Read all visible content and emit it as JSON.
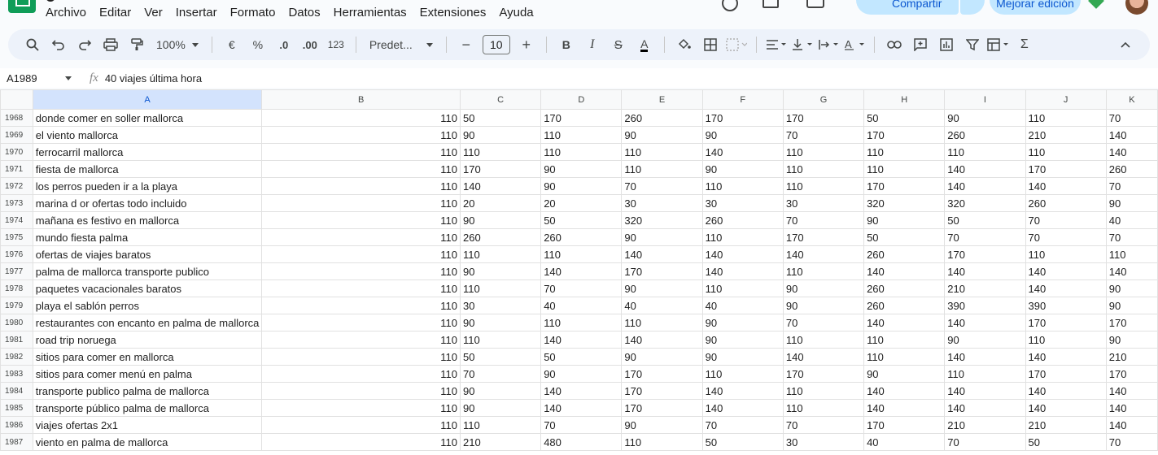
{
  "menubar": [
    "Archivo",
    "Editar",
    "Ver",
    "Insertar",
    "Formato",
    "Datos",
    "Herramientas",
    "Extensiones",
    "Ayuda"
  ],
  "header_buttons": {
    "share": "Compartir",
    "upgrade": "Mejorar edición"
  },
  "toolbar": {
    "zoom": "100%",
    "currency": "€",
    "percent": "%",
    "decrease_decimals": ".0",
    "increase_decimals": ".00",
    "format_123": "123",
    "font": "Predet...",
    "font_size": "10",
    "bold": "B",
    "italic": "I",
    "strike": "S",
    "text_color": "A",
    "sum": "Σ"
  },
  "formula_bar": {
    "cell_ref": "A1989",
    "fx": "fx",
    "value": "40 viajes última hora"
  },
  "columns": [
    "A",
    "B",
    "C",
    "D",
    "E",
    "F",
    "G",
    "H",
    "I",
    "J",
    "K"
  ],
  "rows": [
    {
      "n": "1968",
      "cells": [
        "donde comer en soller mallorca",
        "110",
        "50",
        "170",
        "260",
        "170",
        "170",
        "50",
        "90",
        "110",
        "70"
      ]
    },
    {
      "n": "1969",
      "cells": [
        "el viento mallorca",
        "110",
        "90",
        "110",
        "90",
        "90",
        "70",
        "170",
        "260",
        "210",
        "140"
      ]
    },
    {
      "n": "1970",
      "cells": [
        "ferrocarril mallorca",
        "110",
        "110",
        "110",
        "110",
        "140",
        "110",
        "110",
        "110",
        "110",
        "140"
      ]
    },
    {
      "n": "1971",
      "cells": [
        "fiesta de mallorca",
        "110",
        "170",
        "90",
        "110",
        "90",
        "110",
        "110",
        "140",
        "170",
        "260"
      ]
    },
    {
      "n": "1972",
      "cells": [
        "los perros pueden ir a la playa",
        "110",
        "140",
        "90",
        "70",
        "110",
        "110",
        "170",
        "140",
        "140",
        "70"
      ]
    },
    {
      "n": "1973",
      "cells": [
        "marina d or ofertas todo incluido",
        "110",
        "20",
        "20",
        "30",
        "30",
        "30",
        "320",
        "320",
        "260",
        "90"
      ]
    },
    {
      "n": "1974",
      "cells": [
        "mañana es festivo en mallorca",
        "110",
        "90",
        "50",
        "320",
        "260",
        "70",
        "90",
        "50",
        "70",
        "40"
      ]
    },
    {
      "n": "1975",
      "cells": [
        "mundo fiesta palma",
        "110",
        "260",
        "260",
        "90",
        "110",
        "170",
        "50",
        "70",
        "70",
        "70"
      ]
    },
    {
      "n": "1976",
      "cells": [
        "ofertas de viajes baratos",
        "110",
        "110",
        "110",
        "140",
        "140",
        "140",
        "260",
        "170",
        "110",
        "110"
      ]
    },
    {
      "n": "1977",
      "cells": [
        "palma de mallorca transporte publico",
        "110",
        "90",
        "140",
        "170",
        "140",
        "110",
        "140",
        "140",
        "140",
        "140"
      ]
    },
    {
      "n": "1978",
      "cells": [
        "paquetes vacacionales baratos",
        "110",
        "110",
        "70",
        "90",
        "110",
        "90",
        "260",
        "210",
        "140",
        "90"
      ]
    },
    {
      "n": "1979",
      "cells": [
        "playa el sablón perros",
        "110",
        "30",
        "40",
        "40",
        "40",
        "90",
        "260",
        "390",
        "390",
        "90"
      ]
    },
    {
      "n": "1980",
      "cells": [
        "restaurantes con encanto en palma de mallorca",
        "110",
        "90",
        "110",
        "110",
        "90",
        "70",
        "140",
        "140",
        "170",
        "170"
      ]
    },
    {
      "n": "1981",
      "cells": [
        "road trip noruega",
        "110",
        "110",
        "140",
        "140",
        "90",
        "110",
        "110",
        "90",
        "110",
        "90"
      ]
    },
    {
      "n": "1982",
      "cells": [
        "sitios para comer en mallorca",
        "110",
        "50",
        "50",
        "90",
        "90",
        "140",
        "110",
        "140",
        "140",
        "210"
      ]
    },
    {
      "n": "1983",
      "cells": [
        "sitios para comer menú en palma",
        "110",
        "70",
        "90",
        "170",
        "110",
        "170",
        "90",
        "110",
        "170",
        "170"
      ]
    },
    {
      "n": "1984",
      "cells": [
        "transporte publico palma de mallorca",
        "110",
        "90",
        "140",
        "170",
        "140",
        "110",
        "140",
        "140",
        "140",
        "140"
      ]
    },
    {
      "n": "1985",
      "cells": [
        "transporte público palma de mallorca",
        "110",
        "90",
        "140",
        "170",
        "140",
        "110",
        "140",
        "140",
        "140",
        "140"
      ]
    },
    {
      "n": "1986",
      "cells": [
        "viajes ofertas 2x1",
        "110",
        "110",
        "70",
        "90",
        "70",
        "70",
        "170",
        "210",
        "210",
        "140"
      ]
    },
    {
      "n": "1987",
      "cells": [
        "viento en palma de mallorca",
        "110",
        "210",
        "480",
        "110",
        "50",
        "30",
        "40",
        "70",
        "50",
        "70"
      ]
    }
  ]
}
